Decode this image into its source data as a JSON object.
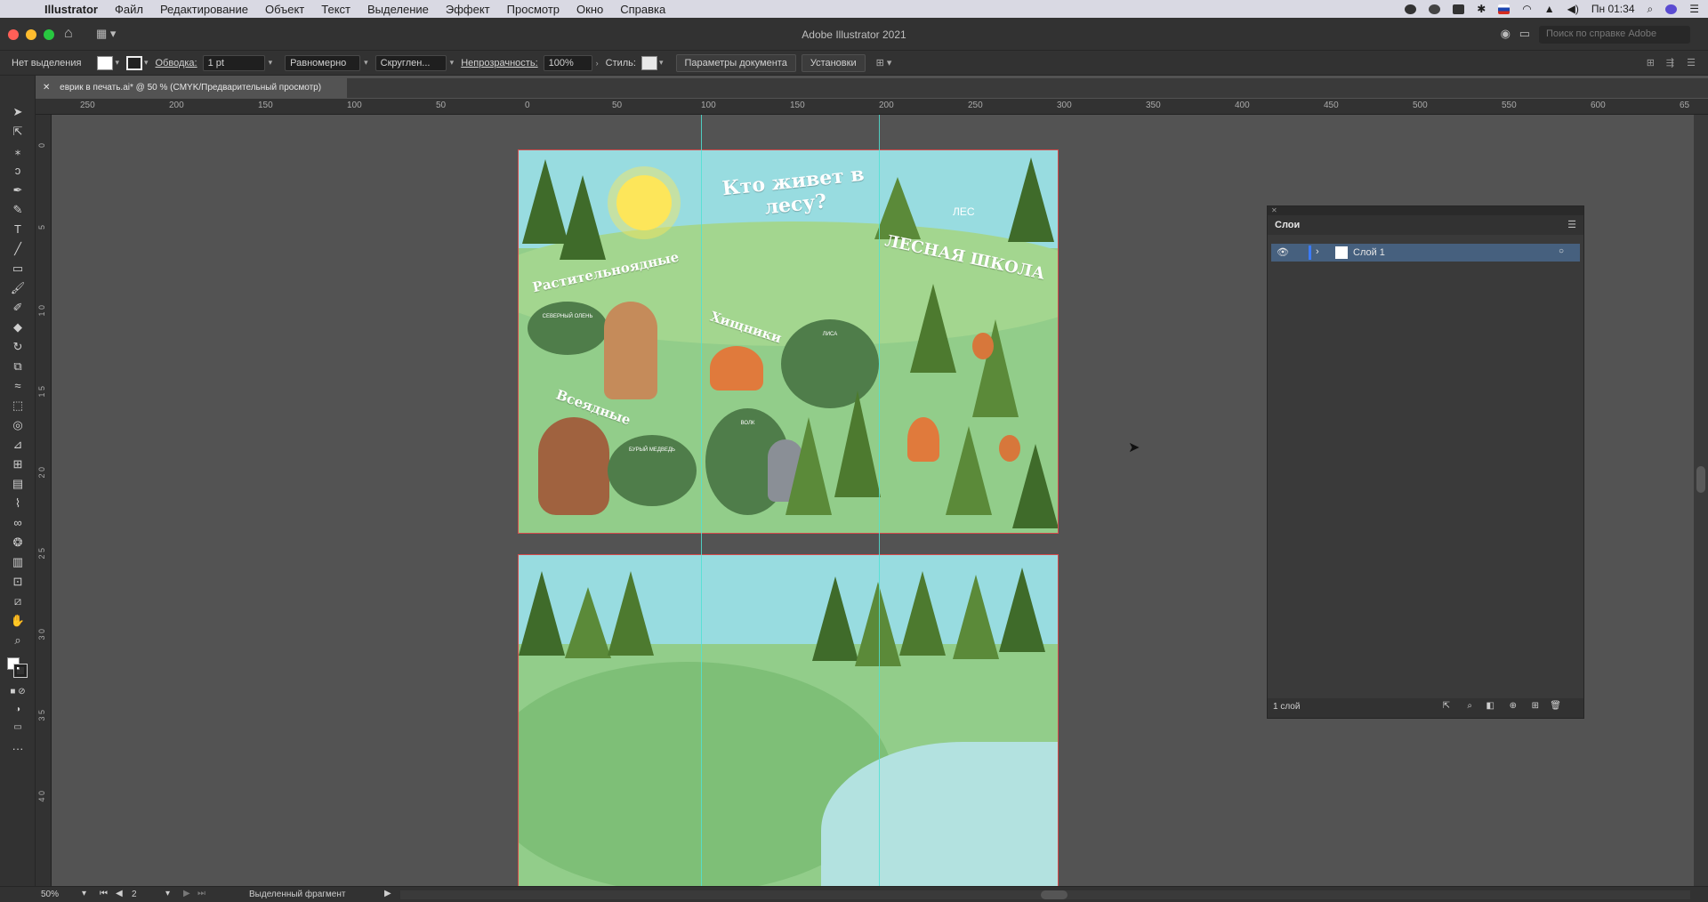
{
  "menubar": {
    "app": "Illustrator",
    "items": [
      "Файл",
      "Редактирование",
      "Объект",
      "Текст",
      "Выделение",
      "Эффект",
      "Просмотр",
      "Окно",
      "Справка"
    ],
    "clock": "Пн 01:34"
  },
  "window": {
    "title": "Adobe Illustrator 2021",
    "help_placeholder": "Поиск по справке Adobe"
  },
  "control": {
    "selection": "Нет выделения",
    "stroke_label": "Обводка:",
    "stroke_value": "1 pt",
    "profile": "Равномерно",
    "brush": "Скруглен...",
    "opacity_label": "Непрозрачность:",
    "opacity_value": "100%",
    "style_label": "Стиль:",
    "doc_setup": "Параметры документа",
    "prefs": "Установки"
  },
  "tab": {
    "title": "еврик в печать.ai* @ 50 % (CMYK/Предварительный просмотр)"
  },
  "ruler": {
    "h_ticks": [
      "250",
      "200",
      "150",
      "100",
      "50",
      "0",
      "50",
      "100",
      "150",
      "200",
      "250",
      "300",
      "350",
      "400",
      "450",
      "500",
      "550",
      "600",
      "65"
    ],
    "v_ticks": [
      "0",
      "5",
      "1 0",
      "1 5",
      "2 0",
      "2 5",
      "3 0",
      "3 5",
      "4 0"
    ]
  },
  "artboard1": {
    "title": "Кто живет в лесу?",
    "school": "ЛЕСНАЯ ШКОЛА",
    "logo": "ЛЕС",
    "herbivores": "Растительноядные",
    "deer": "СЕВЕРНЫЙ ОЛЕНЬ",
    "omnivores": "Всеядные",
    "bear": "БУРЫЙ МЕДВЕДЬ",
    "predators": "Хищники",
    "fox": "ЛИСА",
    "wolf": "ВОЛК"
  },
  "layers": {
    "title": "Слои",
    "layer1": "Слой 1",
    "count": "1 слой"
  },
  "status": {
    "zoom": "50%",
    "page": "2",
    "mode": "Выделенный фрагмент"
  },
  "colors": {
    "guide": "#4fe2d4",
    "sky": "#98dce0",
    "meadow": "#92cd8a",
    "tree": "#5b8a39",
    "bleed": "#d64b4b"
  }
}
